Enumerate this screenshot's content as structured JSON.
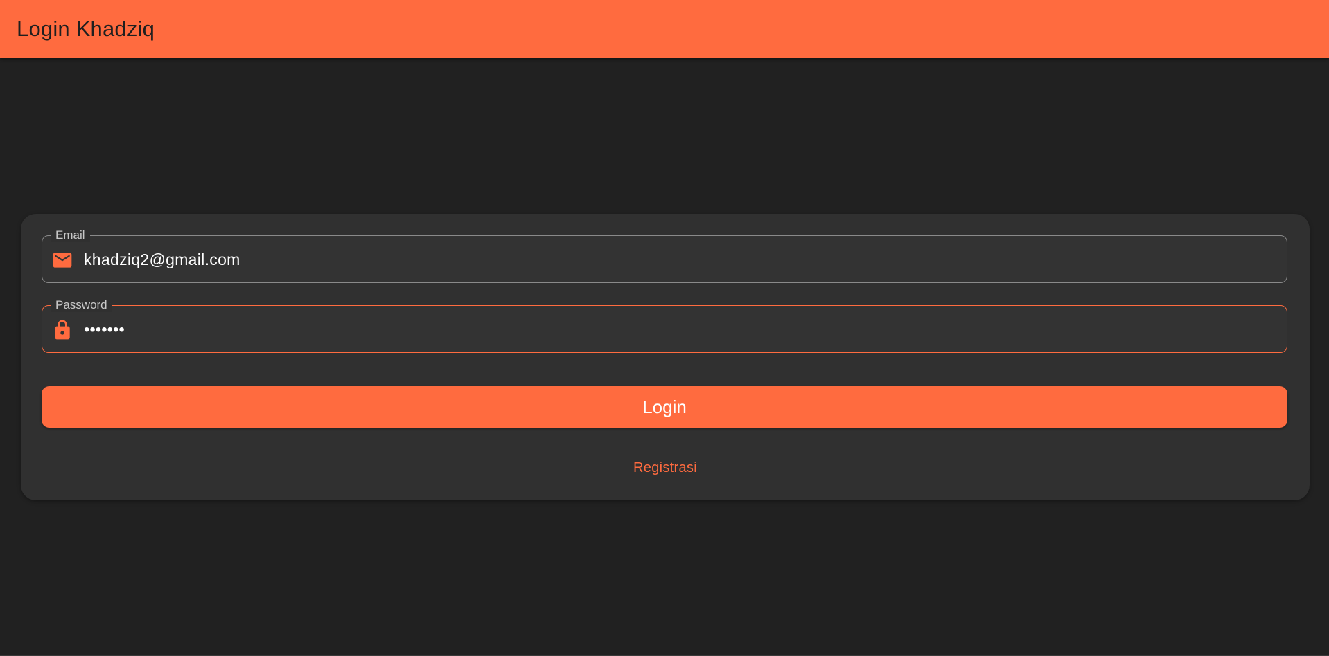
{
  "app_bar": {
    "title": "Login Khadziq"
  },
  "login_form": {
    "email": {
      "label": "Email",
      "value": "khadziq2@gmail.com",
      "icon": "mail-icon"
    },
    "password": {
      "label": "Password",
      "value": "•••••••",
      "icon": "lock-icon"
    },
    "login_button_label": "Login",
    "register_link_label": "Registrasi"
  },
  "colors": {
    "accent": "#FF6B3F",
    "background": "#212121",
    "card": "#303030"
  }
}
